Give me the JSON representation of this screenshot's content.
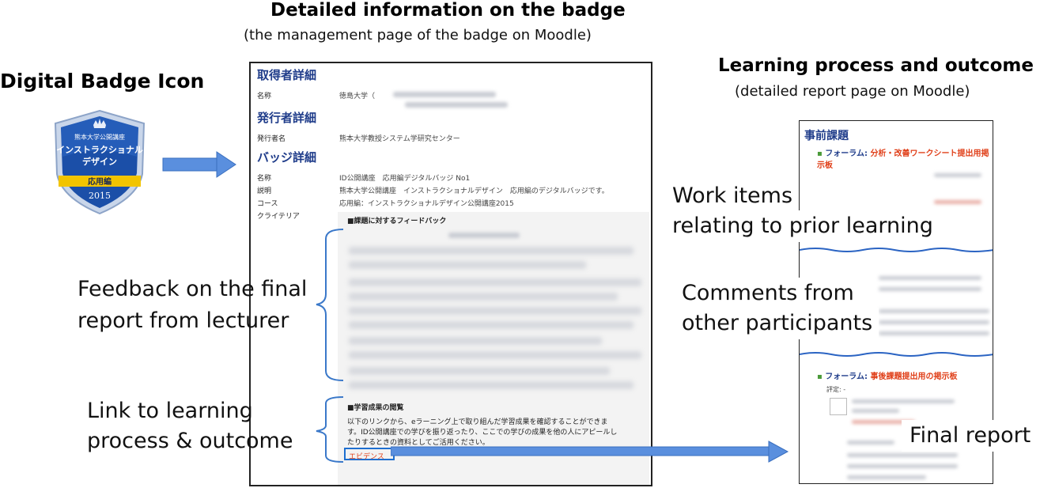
{
  "headings": {
    "badge_icon": "Digital Badge Icon",
    "middle_title": "Detailed information on the badge",
    "middle_subtitle": "(the management page of the badge on Moodle)",
    "right_title": "Learning process and outcome",
    "right_subtitle": "(detailed report page on Moodle)"
  },
  "badge": {
    "line1": "熊本大学公開講座",
    "line2": "インストラクショナル",
    "line3": "デザイン",
    "ribbon": "応用編",
    "year": "2015",
    "colors": {
      "shield": "#1b4fa8",
      "ribbon": "#f2c400",
      "rim": "#c9d6ea"
    }
  },
  "middle_panel": {
    "recipient_heading": "取得者詳細",
    "name_key": "名称",
    "name_val": "徳島大学（",
    "issuer_heading": "発行者詳細",
    "issuer_key": "発行者名",
    "issuer_val": "熊本大学教授システム学研究センター",
    "badge_heading": "バッジ詳細",
    "rows": [
      {
        "key": "名称",
        "val": "ID公開講座　応用編デジタルバッジ No1"
      },
      {
        "key": "説明",
        "val": "熊本大学公開講座　インストラクショナルデザイン　応用編のデジタルバッジです。"
      },
      {
        "key": "コース",
        "val": "応用編：インストラクショナルデザイン公開講座2015"
      },
      {
        "key": "クライテリア",
        "val": ""
      }
    ],
    "feedback_heading": "■課題に対するフィードバック",
    "outcome_heading": "■学習成果の閲覧",
    "outcome_text": [
      "以下のリンクから、eラーニング上で取り組んだ学習成果を確認することができま",
      "す。ID公開講座での学びを振り返ったり、ここでの学びの成果を他の人にアピールし",
      "たりするときの資料としてご活用ください。"
    ],
    "evidence_link": "エビデンス"
  },
  "right_panel": {
    "heading": "事前課題",
    "forum1_prefix": "フォーラム: ",
    "forum1_title": "分析・改善ワークシート提出用掲示板",
    "forum2_prefix": "フォーラム: ",
    "forum2_title": "事後課題提出用の掲示板",
    "eval_label": "評定: -"
  },
  "labels": {
    "feedback": [
      "Feedback on the final",
      "report from lecturer"
    ],
    "link": [
      "Link to learning",
      "process & outcome"
    ],
    "work_items": [
      "Work items",
      "relating to prior learning"
    ],
    "comments": [
      "Comments from",
      "other participants"
    ],
    "final_report": "Final report"
  },
  "colors": {
    "arrow": "#4f88d8",
    "brace": "#3a78c9",
    "jp_heading": "#1f3c8a",
    "forum_red": "#e0401a"
  }
}
